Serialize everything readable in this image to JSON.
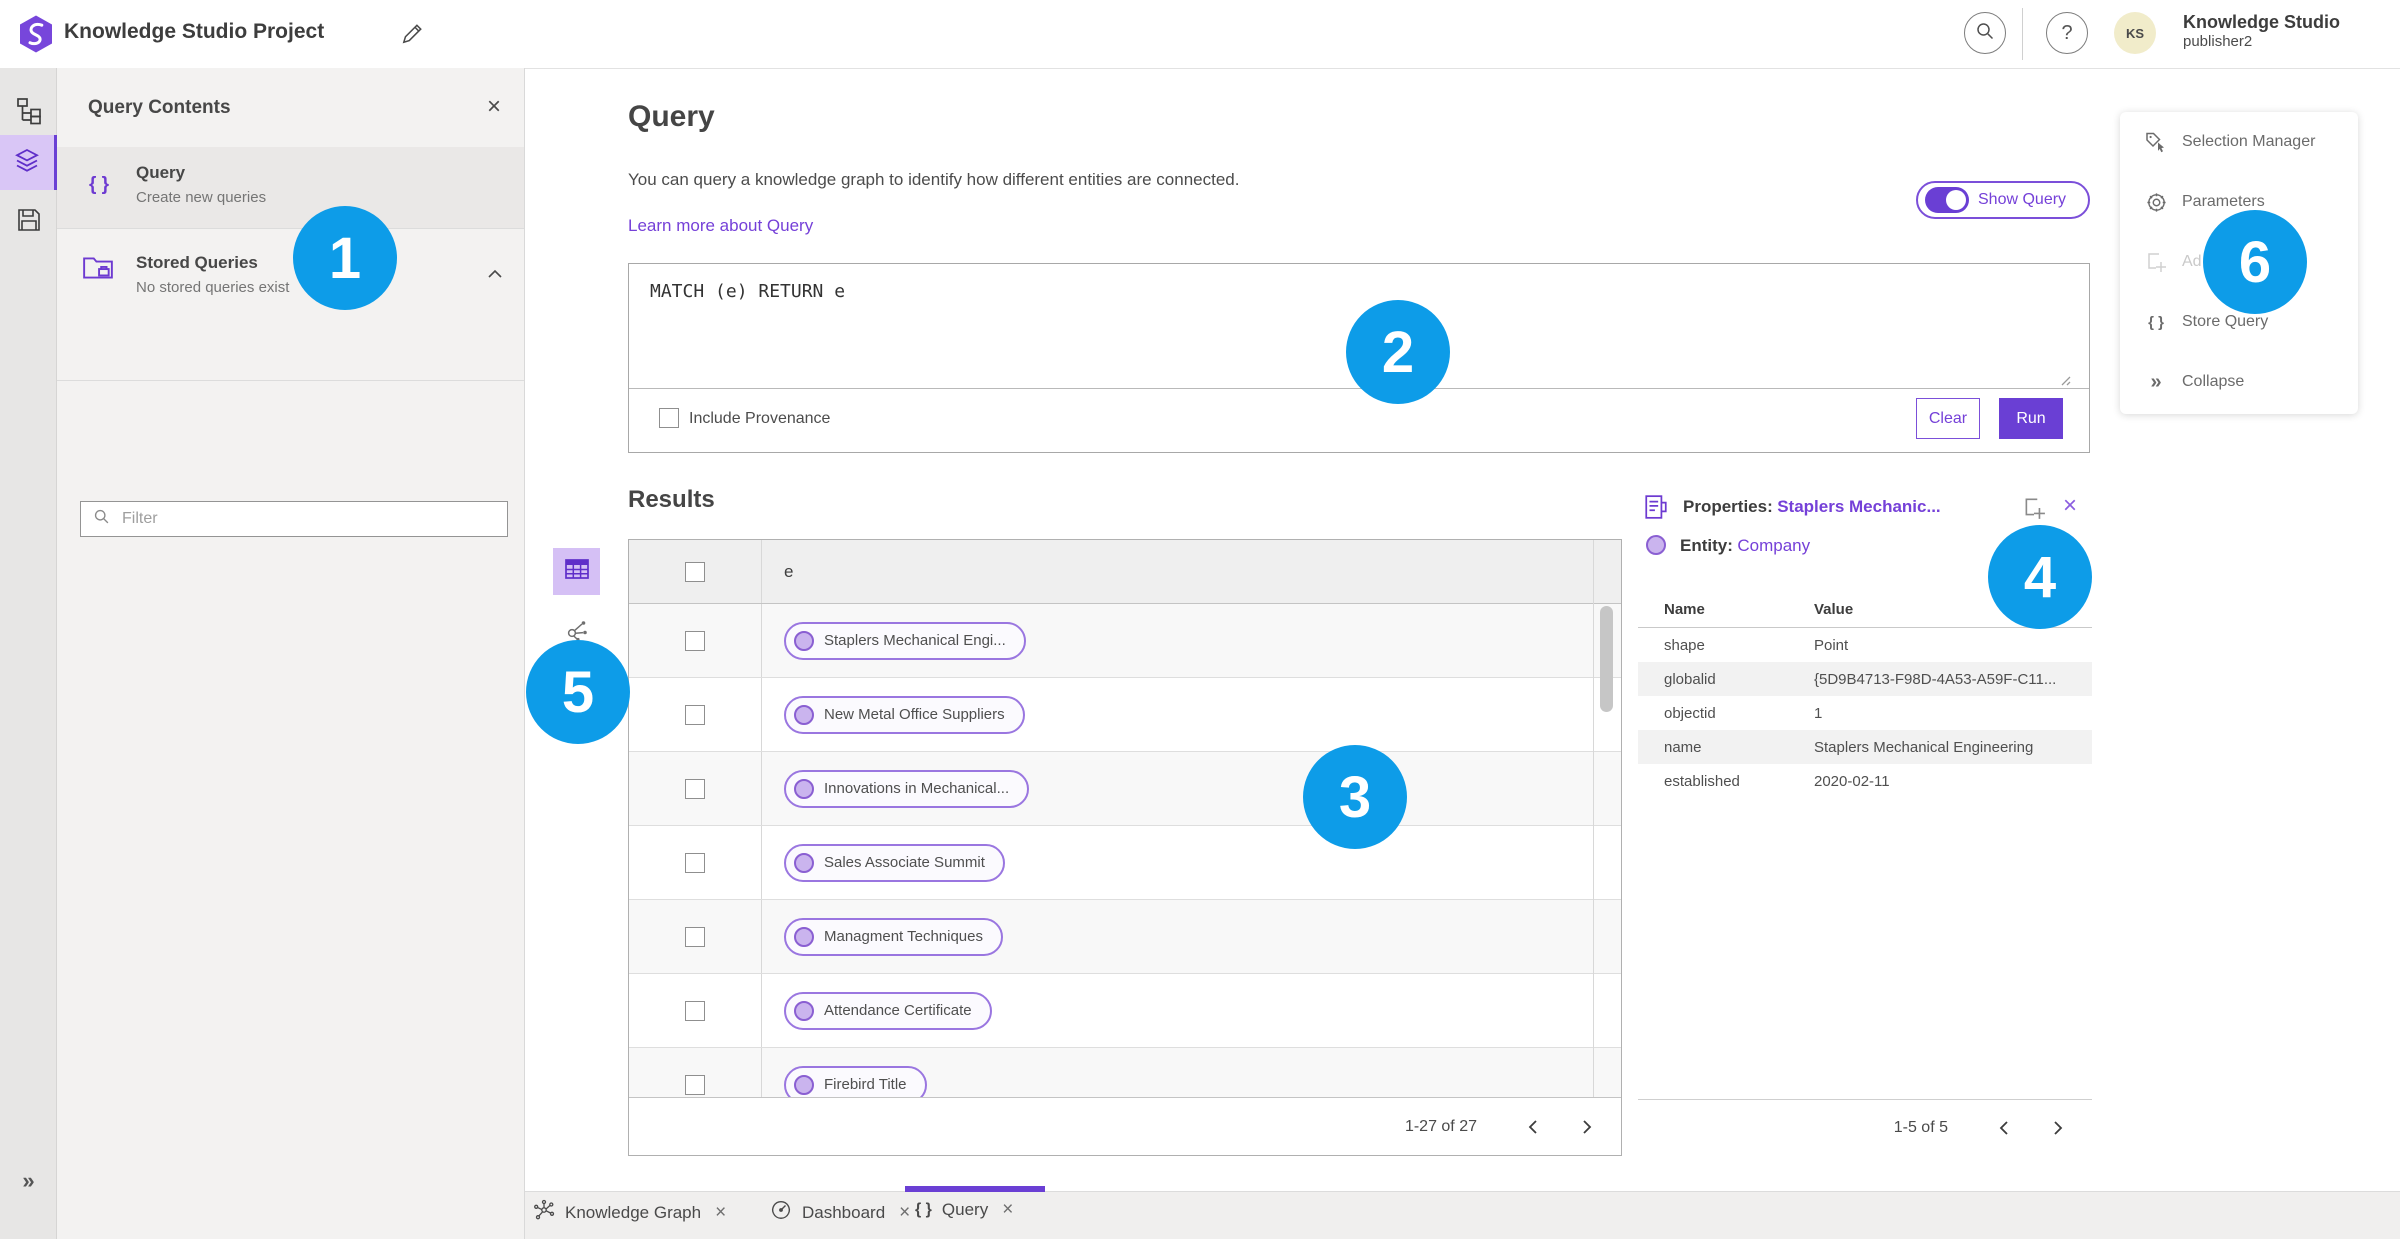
{
  "topbar": {
    "title": "Knowledge Studio Project",
    "user_name": "Knowledge Studio",
    "user_role": "publisher2",
    "avatar_initials": "KS"
  },
  "icons": {
    "braces": "{ }",
    "collapse_chevrons": "»",
    "expand_chevrons": "»",
    "help": "?",
    "close": "×"
  },
  "contents_panel": {
    "title": "Query Contents",
    "query_item": {
      "label": "Query",
      "description": "Create new queries"
    },
    "stored_item": {
      "label": "Stored Queries",
      "description": "No stored queries exist"
    },
    "filter_placeholder": "Filter"
  },
  "query_section": {
    "title": "Query",
    "description": "You can query a knowledge graph to identify how different entities are connected.",
    "learn_more_label": "Learn more about Query",
    "show_query_label": "Show Query",
    "query_text": "MATCH (e) RETURN e",
    "include_provenance_label": "Include Provenance",
    "clear_label": "Clear",
    "run_label": "Run"
  },
  "results": {
    "title": "Results",
    "column_header": "e",
    "rows": [
      "Staplers Mechanical Engi...",
      "New Metal Office Suppliers",
      "Innovations in Mechanical...",
      "Sales Associate Summit",
      "Managment Techniques",
      "Attendance Certificate",
      "Firebird Title"
    ],
    "pagination": "1-27 of 27"
  },
  "properties": {
    "title_prefix": "Properties:",
    "title_link": "Staplers Mechanic...",
    "entity_prefix": "Entity:",
    "entity_value": "Company",
    "name_header": "Name",
    "value_header": "Value",
    "rows": [
      {
        "name": "shape",
        "value": "Point"
      },
      {
        "name": "globalid",
        "value": "{5D9B4713-F98D-4A53-A59F-C11..."
      },
      {
        "name": "objectid",
        "value": "1"
      },
      {
        "name": "name",
        "value": "Staplers Mechanical Engineering"
      },
      {
        "name": "established",
        "value": "2020-02-11"
      }
    ],
    "pagination": "1-5 of 5"
  },
  "side_menu": {
    "items": [
      "Selection Manager",
      "Parameters",
      "Ad",
      "Store Query",
      "Collapse"
    ]
  },
  "bottom_tabs": {
    "tabs": [
      "Knowledge Graph",
      "Dashboard",
      "Query"
    ]
  },
  "callouts": [
    "1",
    "2",
    "3",
    "4",
    "5",
    "6"
  ],
  "colors": {
    "accent_purple": "#6d3ad1",
    "run_purple": "#6a3fd4",
    "link_purple": "#7540d8",
    "badge_blue": "#0d9ce8",
    "avatar_bg": "#f1ecca"
  }
}
